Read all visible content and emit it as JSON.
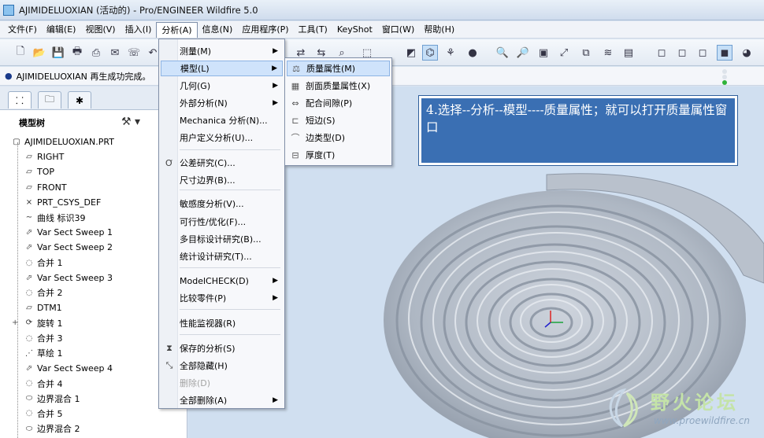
{
  "window": {
    "title": "AJIMIDELUOXIAN (活动的) - Pro/ENGINEER Wildfire 5.0"
  },
  "menubar": {
    "items": [
      "文件(F)",
      "编辑(E)",
      "视图(V)",
      "插入(I)",
      "分析(A)",
      "信息(N)",
      "应用程序(P)",
      "工具(T)",
      "KeyShot",
      "窗口(W)",
      "帮助(H)"
    ]
  },
  "status": {
    "message": "AJIMIDELUOXIAN 再生成功完成。"
  },
  "navigator": {
    "heading": "模型树",
    "items": [
      {
        "label": "AJIMIDELUOXIAN.PRT",
        "icon": "part-icon"
      },
      {
        "label": "RIGHT",
        "icon": "datum-plane-icon"
      },
      {
        "label": "TOP",
        "icon": "datum-plane-icon"
      },
      {
        "label": "FRONT",
        "icon": "datum-plane-icon"
      },
      {
        "label": "PRT_CSYS_DEF",
        "icon": "csys-icon"
      },
      {
        "label": "曲线 标识39",
        "icon": "curve-icon"
      },
      {
        "label": "Var Sect Sweep 1",
        "icon": "sweep-icon"
      },
      {
        "label": "Var Sect Sweep 2",
        "icon": "sweep-icon"
      },
      {
        "label": "合并 1",
        "icon": "merge-icon"
      },
      {
        "label": "Var Sect Sweep 3",
        "icon": "sweep-icon"
      },
      {
        "label": "合并 2",
        "icon": "merge-icon"
      },
      {
        "label": "DTM1",
        "icon": "datum-plane-icon"
      },
      {
        "label": "旋转 1",
        "icon": "revolve-icon"
      },
      {
        "label": "合并 3",
        "icon": "merge-icon"
      },
      {
        "label": "草绘 1",
        "icon": "sketch-icon"
      },
      {
        "label": "Var Sect Sweep 4",
        "icon": "sweep-icon"
      },
      {
        "label": "合并 4",
        "icon": "merge-icon"
      },
      {
        "label": "边界混合 1",
        "icon": "boundary-blend-icon"
      },
      {
        "label": "合并 5",
        "icon": "merge-icon"
      },
      {
        "label": "边界混合 2",
        "icon": "boundary-blend-icon"
      }
    ]
  },
  "analysis_menu": {
    "items": [
      {
        "label": "测量(M)",
        "submenu": true
      },
      {
        "label": "模型(L)",
        "submenu": true,
        "highlighted": true
      },
      {
        "label": "几何(G)",
        "submenu": true
      },
      {
        "label": "外部分析(N)",
        "submenu": true
      },
      {
        "label": "Mechanica 分析(N)...",
        "submenu": false
      },
      {
        "label": "用户定义分析(U)...",
        "submenu": false
      },
      {
        "label": "公差研究(C)...",
        "submenu": false,
        "icon": "tolerance-icon"
      },
      {
        "label": "尺寸边界(B)...",
        "submenu": false
      },
      {
        "label": "敏感度分析(V)...",
        "submenu": false
      },
      {
        "label": "可行性/优化(F)...",
        "submenu": false
      },
      {
        "label": "多目标设计研究(B)...",
        "submenu": false
      },
      {
        "label": "统计设计研究(T)...",
        "submenu": false
      },
      {
        "label": "ModelCHECK(D)",
        "submenu": true
      },
      {
        "label": "比较零件(P)",
        "submenu": true
      },
      {
        "label": "性能监视器(R)",
        "submenu": false
      },
      {
        "label": "保存的分析(S)",
        "submenu": false,
        "icon": "saved-analysis-icon"
      },
      {
        "label": "全部隐藏(H)",
        "submenu": false,
        "icon": "hide-all-icon"
      },
      {
        "label": "删除(D)",
        "submenu": false,
        "disabled": true
      },
      {
        "label": "全部删除(A)",
        "submenu": true
      }
    ]
  },
  "model_submenu": {
    "items": [
      {
        "label": "质量属性(M)",
        "icon": "mass-properties-icon",
        "highlighted": true
      },
      {
        "label": "剖面质量属性(X)",
        "icon": "section-mass-icon"
      },
      {
        "label": "配合间隙(P)",
        "icon": "clearance-icon"
      },
      {
        "label": "短边(S)",
        "icon": "short-edge-icon"
      },
      {
        "label": "边类型(D)",
        "icon": "edge-type-icon"
      },
      {
        "label": "厚度(T)",
        "icon": "thickness-icon"
      }
    ]
  },
  "callout": {
    "text": "4.选择--分析--模型----质量属性；就可以打开质量属性窗口"
  },
  "watermark": {
    "title": "野火论坛",
    "url": "www.proewildfire.cn"
  },
  "colors": {
    "callout_bg": "#3a6fb3",
    "menu_highlight": "#cfe3fb",
    "viewport_bg": "#d0dff0"
  }
}
